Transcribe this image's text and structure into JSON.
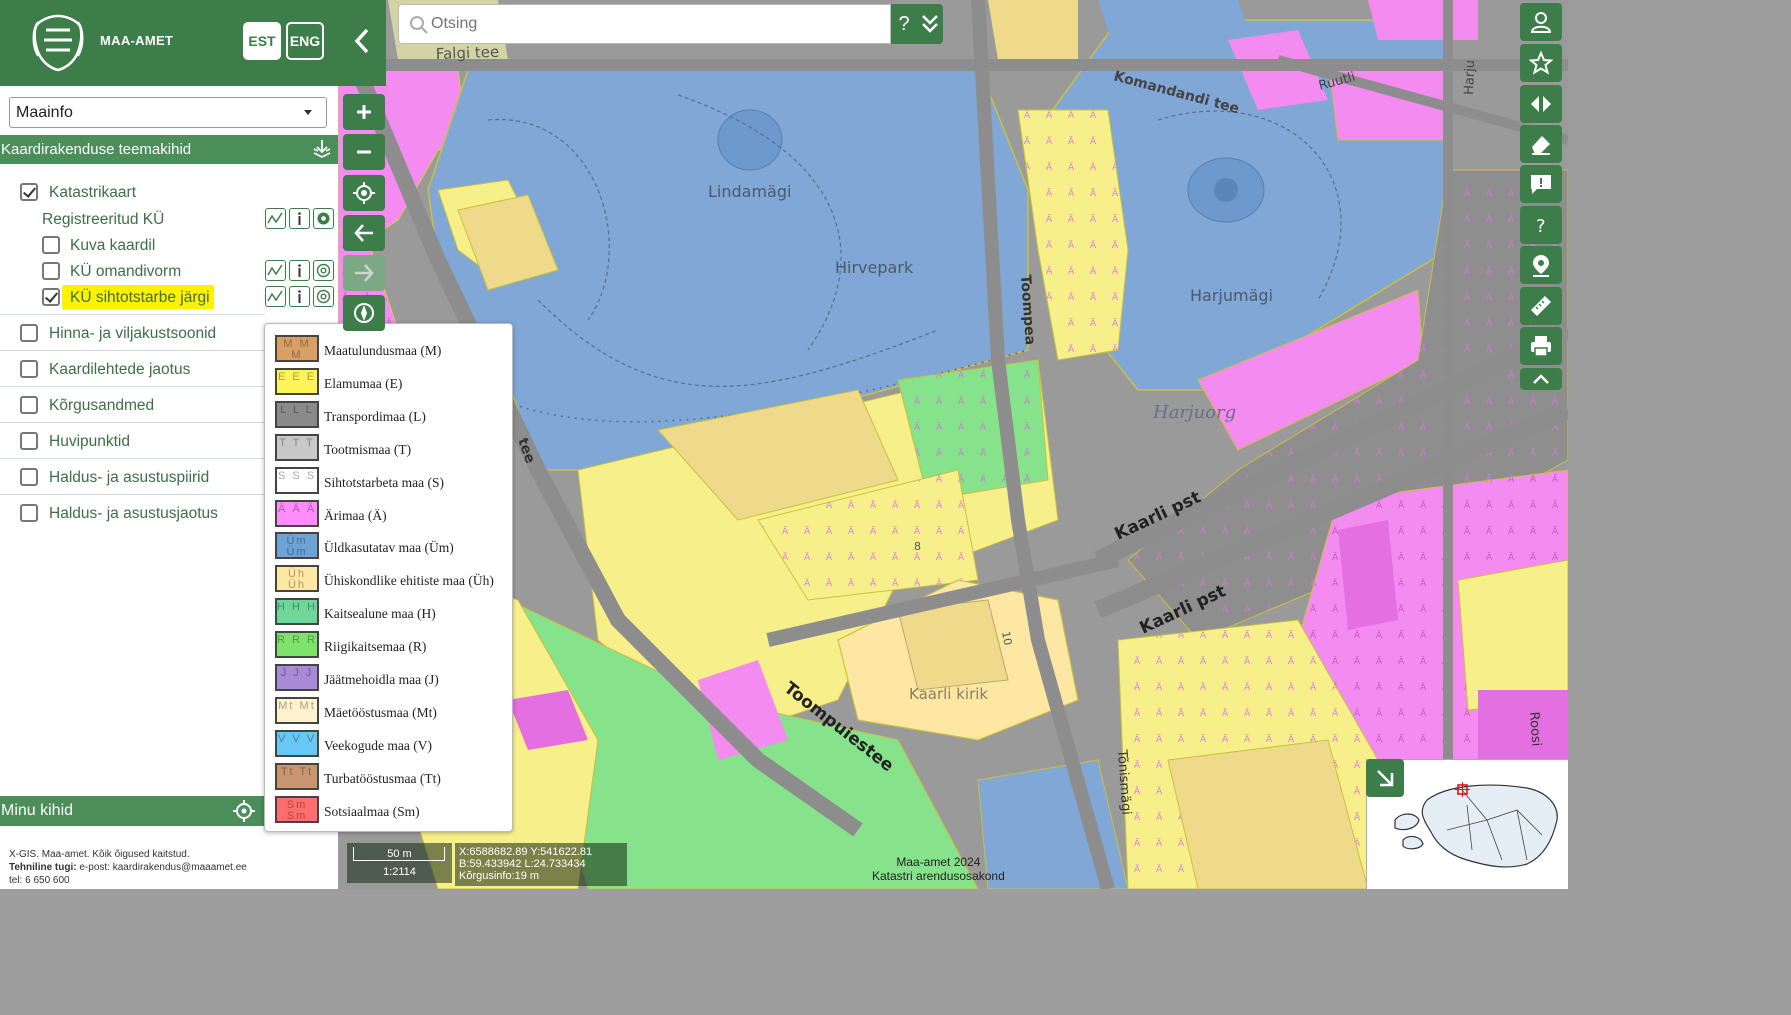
{
  "header": {
    "brand": "MAA-AMET",
    "lang_est": "EST",
    "lang_eng": "ENG"
  },
  "app_select": {
    "value": "Maainfo"
  },
  "theme_bar": {
    "title": "Kaardirakenduse teemakihid"
  },
  "layers": {
    "katastrikaart": {
      "label": "Katastrikaart",
      "checked": true
    },
    "registreeritud": {
      "label": "Registreeritud KÜ"
    },
    "kuva_kaardil": {
      "label": "Kuva kaardil",
      "checked": false
    },
    "omandivorm": {
      "label": "KÜ omandivorm",
      "checked": false
    },
    "sihtotstarve": {
      "label": "KÜ sihtotstarbe järgi",
      "checked": true
    },
    "groups": [
      {
        "label": "Hinna- ja viljakustsoonid",
        "checked": false
      },
      {
        "label": "Kaardilehtede jaotus",
        "checked": false
      },
      {
        "label": "Kõrgusandmed",
        "checked": false
      },
      {
        "label": "Huvipunktid",
        "checked": false
      },
      {
        "label": "Haldus- ja asustuspiirid",
        "checked": false
      },
      {
        "label": "Haldus- ja asustusjaotus",
        "checked": false
      }
    ]
  },
  "minu_kihid": {
    "title": "Minu kihid"
  },
  "footer": {
    "line1": "X-GIS. Maa-amet. Kõik õigused kaitstud.",
    "support_label": "Tehniline tugi:",
    "support_text": " e-post: kaardirakendus@maaamet.ee",
    "phone": "tel: 6 650 600"
  },
  "legend": {
    "items": [
      {
        "label": "Maatulundusmaa (M)",
        "code": "M M M",
        "color": "#d9a066"
      },
      {
        "label": "Elamumaa (E)",
        "code": "E E E",
        "color": "#fff35a"
      },
      {
        "label": "Transpordimaa (L)",
        "code": "L L L",
        "color": "#8a8a8a"
      },
      {
        "label": "Tootmismaa (T)",
        "code": "T T T",
        "color": "#c8c8c8"
      },
      {
        "label": "Sihtotstarbeta maa (S)",
        "code": "S S S",
        "color": "#ffffff"
      },
      {
        "label": "Ärimaa (Ä)",
        "code": "Ä Ä Ä",
        "color": "#ff8cff"
      },
      {
        "label": "Üldkasutatav maa (Üm)",
        "code": "Üm Üm",
        "color": "#6ea3d8"
      },
      {
        "label": "Ühiskondlike ehitiste maa (Üh)",
        "code": "Üh Üh",
        "color": "#fde7a3"
      },
      {
        "label": "Kaitsealune maa (H)",
        "code": "H H H",
        "color": "#6fd69a"
      },
      {
        "label": "Riigikaitsemaa (R)",
        "code": "R R R",
        "color": "#7fe36b"
      },
      {
        "label": "Jäätmehoidla maa (J)",
        "code": "J J J",
        "color": "#a98ad9"
      },
      {
        "label": "Mäetööstusmaa (Mt)",
        "code": "Mt Mt",
        "color": "#fff2d0"
      },
      {
        "label": "Veekogude maa (V)",
        "code": "V V V",
        "color": "#67c8f5"
      },
      {
        "label": "Turbatööstusmaa (Tt)",
        "code": "Tt Tt",
        "color": "#c79670"
      },
      {
        "label": "Sotsiaalmaa (Sm)",
        "code": "Sm Sm",
        "color": "#ff6d6d"
      }
    ]
  },
  "search": {
    "placeholder": "Otsing",
    "help": "?"
  },
  "map_labels": {
    "falgi": "Falgi tee",
    "komandandi": "Komandandi tee",
    "ruutli": "Ruutli",
    "harju": "Harju",
    "lindamagi": "Lindamägi",
    "hirvepark": "Hirvepark",
    "harjumagi": "Harjumägi",
    "harjuorg": "Harjuorg",
    "toompea": "Toompea",
    "kaarli_pst_1": "Kaarli pst",
    "kaarli_pst_2": "Kaarli pst",
    "toompuiestee": "Toompuiestee",
    "kaarli_kirik": "Kaarli kirik",
    "tonismagi": "Tõnismägi",
    "roosi": "Roosi",
    "tee": "tee",
    "house_10": "10",
    "house_8": "8"
  },
  "scale": {
    "distance": "50 m",
    "ratio": "1:2114"
  },
  "coords": {
    "xy": "X:6588682.89 Y:541622.81",
    "bl": "B:59.433942 L:24.733434",
    "height": "Kõrgusinfo:19 m"
  },
  "credits": {
    "line1": "Maa-amet 2024",
    "line2": "Katastri arendusosakond"
  },
  "colors": {
    "brand_green": "#3c7d4a",
    "bar_green": "#4b8e5a",
    "highlight": "#fff200"
  }
}
